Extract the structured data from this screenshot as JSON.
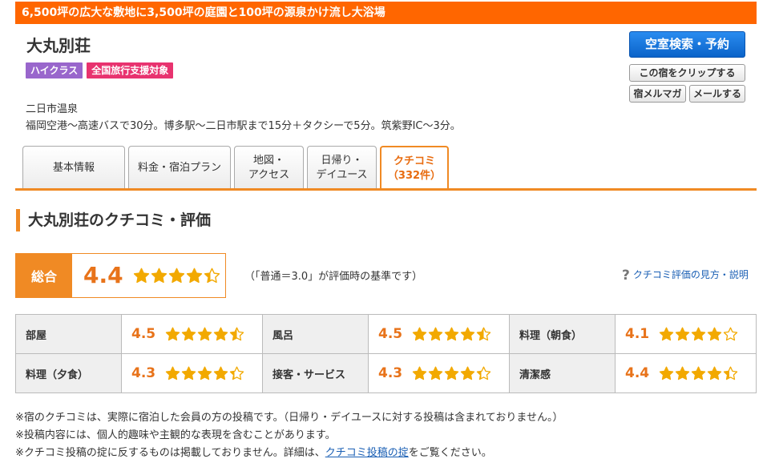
{
  "header": {
    "catch_copy": "6,500坪の広大な敷地に3,500坪の庭園と100坪の源泉かけ流し大浴場",
    "hotel_name": "大丸別荘",
    "badges": [
      "ハイクラス",
      "全国旅行支援対象"
    ],
    "area": "二日市温泉",
    "access": "福岡空港～高速バスで30分。博多駅～二日市駅まで15分＋タクシーで5分。筑紫野IC～3分。"
  },
  "actions": {
    "reserve": "空室検索・予約",
    "clip": "この宿をクリップする",
    "magazine": "宿メルマガ",
    "mail": "メールする"
  },
  "tabs": [
    {
      "line1": "基本情報",
      "line2": ""
    },
    {
      "line1": "料金・宿泊プラン",
      "line2": ""
    },
    {
      "line1": "地図・",
      "line2": "アクセス"
    },
    {
      "line1": "日帰り・",
      "line2": "デイユース"
    },
    {
      "line1": "クチコミ",
      "line2": "（332件）"
    }
  ],
  "active_tab": 4,
  "reviews": {
    "section_title": "大丸別荘のクチコミ・評価",
    "overall_label": "総合",
    "overall_score": "4.4",
    "overall_value": 4.4,
    "baseline_note": "（「普通＝3.0」が評価時の基準です）",
    "help_link": "クチコミ評価の見方・説明",
    "categories": [
      {
        "name": "部屋",
        "score": "4.5",
        "value": 4.5
      },
      {
        "name": "風呂",
        "score": "4.5",
        "value": 4.5
      },
      {
        "name": "料理（朝食）",
        "score": "4.1",
        "value": 4.1
      },
      {
        "name": "料理（夕食）",
        "score": "4.3",
        "value": 4.3
      },
      {
        "name": "接客・サービス",
        "score": "4.3",
        "value": 4.3
      },
      {
        "name": "清潔感",
        "score": "4.4",
        "value": 4.4
      }
    ]
  },
  "footer": {
    "line1": "※宿のクチコミは、実際に宿泊した会員の方の投稿です。（日帰り・デイユースに対する投稿は含まれておりません。）",
    "line2": "※投稿内容には、個人的趣味や主観的な表現を含むことがあります。",
    "line3_prefix": "※クチコミ投稿の掟に反するものは掲載しておりません。詳細は、",
    "line3_link": "クチコミ投稿の掟",
    "line3_suffix": "をご覧ください。"
  },
  "colors": {
    "accent": "#f08a24",
    "catch_bg": "#ff6600",
    "score": "#e8731a",
    "star": "#f2a900",
    "link": "#1a5fb4",
    "reserve_button": "#1a73e8"
  }
}
